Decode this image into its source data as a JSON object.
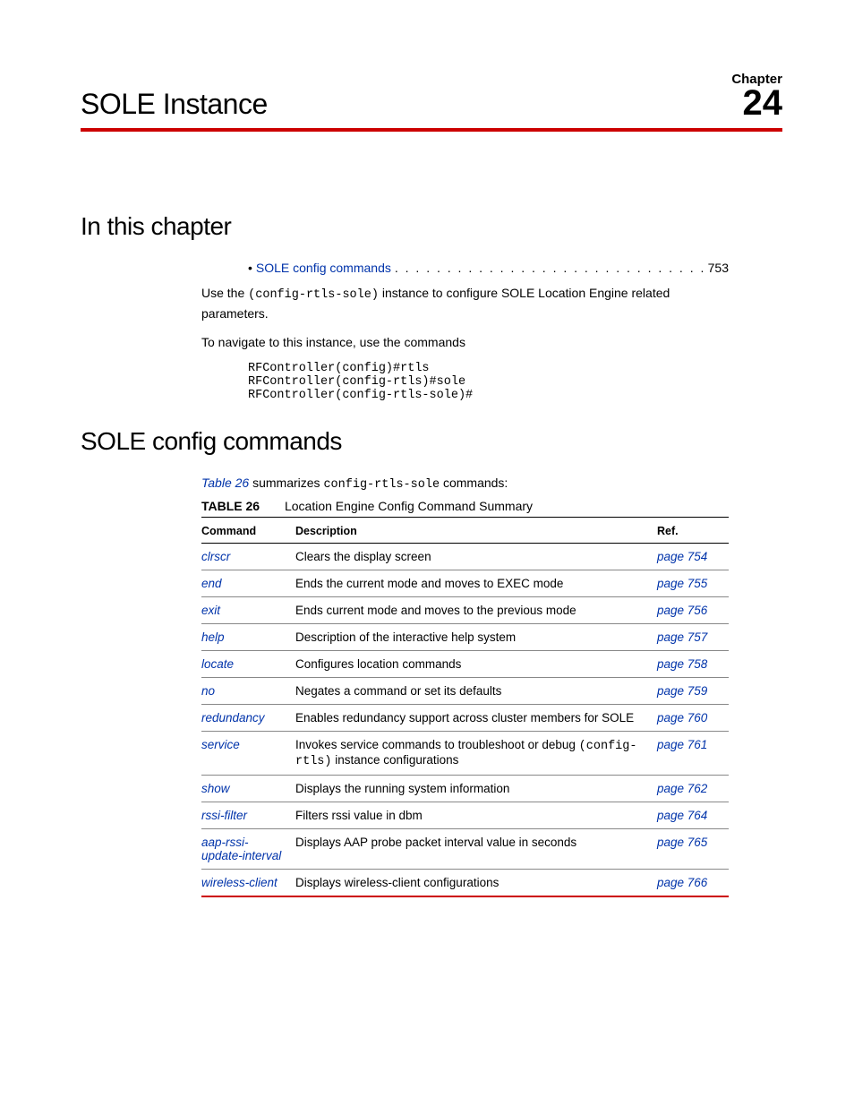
{
  "chapter": {
    "label": "Chapter",
    "number": "24",
    "title": "SOLE Instance"
  },
  "sections": {
    "inThisChapter": "In this chapter",
    "soleConfig": "SOLE config commands"
  },
  "toc": {
    "label": "SOLE config commands",
    "dots": " . . . . . . . . . . . . . . . . . . . . . . . . . . . . . . . . . . . . . . . . .",
    "page": "753"
  },
  "intro": {
    "useThePrefix": "Use the ",
    "instanceCode": "(config-rtls-sole)",
    "useTheSuffix": " instance to configure SOLE Location Engine related parameters.",
    "navigate": "To navigate to this instance, use the commands",
    "code": "RFController(config)#rtls\nRFController(config-rtls)#sole\nRFController(config-rtls-sole)#"
  },
  "summary": {
    "refLabel": "Table 26",
    "mid": " summarizes ",
    "code": "config-rtls-sole",
    "tail": " commands:"
  },
  "table": {
    "label": "TABLE 26",
    "caption": "Location Engine Config Command Summary",
    "headers": {
      "command": "Command",
      "description": "Description",
      "ref": "Ref."
    },
    "rows": [
      {
        "command": "clrscr",
        "desc": "Clears the display screen",
        "ref": "page 754"
      },
      {
        "command": "end",
        "desc": "Ends the current mode and moves to EXEC mode",
        "ref": "page 755"
      },
      {
        "command": "exit",
        "desc": "Ends current mode and moves to the previous mode",
        "ref": "page 756"
      },
      {
        "command": "help",
        "desc": "Description of the interactive help system",
        "ref": "page 757"
      },
      {
        "command": "locate",
        "desc": "Configures location commands",
        "ref": "page 758"
      },
      {
        "command": "no",
        "desc": "Negates a command or set its defaults",
        "ref": "page 759"
      },
      {
        "command": "redundancy",
        "desc": "Enables redundancy support across cluster members for SOLE",
        "ref": "page 760"
      },
      {
        "command": "service",
        "descPrefix": "Invokes service commands to troubleshoot or debug ",
        "descCode": "(config-rtls)",
        "descSuffix": " instance configurations",
        "ref": "page 761"
      },
      {
        "command": "show",
        "desc": "Displays the running system information",
        "ref": "page 762"
      },
      {
        "command": "rssi-filter",
        "desc": "Filters rssi value in dbm",
        "ref": "page 764"
      },
      {
        "command": "aap-rssi-update-interval",
        "desc": "Displays AAP probe packet interval value in seconds",
        "ref": "page 765"
      },
      {
        "command": "wireless-client",
        "desc": "Displays wireless-client configurations",
        "ref": "page 766"
      }
    ]
  }
}
